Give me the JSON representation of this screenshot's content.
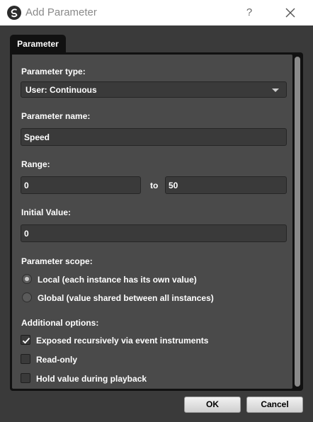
{
  "window": {
    "title": "Add Parameter",
    "help_glyph": "?"
  },
  "tabs": [
    {
      "label": "Parameter"
    }
  ],
  "form": {
    "type_label": "Parameter type:",
    "type_value": "User: Continuous",
    "name_label": "Parameter name:",
    "name_value": "Speed",
    "range_label": "Range:",
    "range_min": "0",
    "range_to": "to",
    "range_max": "50",
    "initial_label": "Initial Value:",
    "initial_value": "0",
    "scope_label": "Parameter scope:",
    "scope_options": [
      {
        "label": "Local (each instance has its own value)",
        "checked": true
      },
      {
        "label": "Global (value shared between all instances)",
        "checked": false
      }
    ],
    "options_label": "Additional options:",
    "options": [
      {
        "label": "Exposed recursively via event instruments",
        "checked": true
      },
      {
        "label": "Read-only",
        "checked": false
      },
      {
        "label": "Hold value during playback",
        "checked": false
      }
    ]
  },
  "buttons": {
    "ok": "OK",
    "cancel": "Cancel"
  },
  "colors": {
    "panel": "#4a4a4a",
    "field": "#3a3a3a",
    "border": "#111111",
    "text": "#ffffff"
  }
}
